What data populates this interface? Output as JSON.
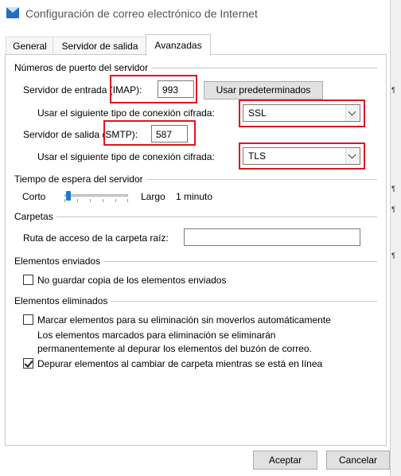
{
  "window": {
    "title": "Configuración de correo electrónico de Internet"
  },
  "tabs": [
    {
      "label": "General",
      "active": false
    },
    {
      "label": "Servidor de salida",
      "active": false
    },
    {
      "label": "Avanzadas",
      "active": true
    }
  ],
  "ports": {
    "group_label": "Números de puerto del servidor",
    "incoming_label_prefix": "Servidor de entrada ",
    "incoming_label_tag": "(IMAP):",
    "incoming_value": "993",
    "defaults_button": "Usar predeterminados",
    "enc_label": "Usar el siguiente tipo de conexión cifrada:",
    "incoming_encryption": "SSL",
    "outgoing_label_prefix": "Servidor de salida ",
    "outgoing_label_tag": "(SMTP):",
    "outgoing_value": "587",
    "outgoing_encryption": "TLS"
  },
  "timeout": {
    "group_label": "Tiempo de espera del servidor",
    "short_label": "Corto",
    "long_label": "Largo",
    "value_label": "1 minuto",
    "level": 0.06
  },
  "folders": {
    "group_label": "Carpetas",
    "root_label": "Ruta de acceso de la carpeta raíz:",
    "root_value": ""
  },
  "sent": {
    "group_label": "Elementos enviados",
    "no_copy_label": "No guardar copia de los elementos enviados",
    "no_copy_checked": false
  },
  "deleted": {
    "group_label": "Elementos eliminados",
    "mark_label": "Marcar elementos para su eliminación sin moverlos automáticamente",
    "mark_checked": false,
    "note_line1": "Los elementos marcados para eliminación se eliminarán",
    "note_line2": "permanentemente al depurar los elementos del buzón de correo.",
    "purge_label": "Depurar elementos al cambiar de carpeta mientras se está en línea",
    "purge_checked": true
  },
  "footer": {
    "ok_label": "Aceptar",
    "cancel_label": "Cancelar"
  },
  "colors": {
    "highlight": "#e0151e",
    "accent": "#1c7ad4"
  }
}
